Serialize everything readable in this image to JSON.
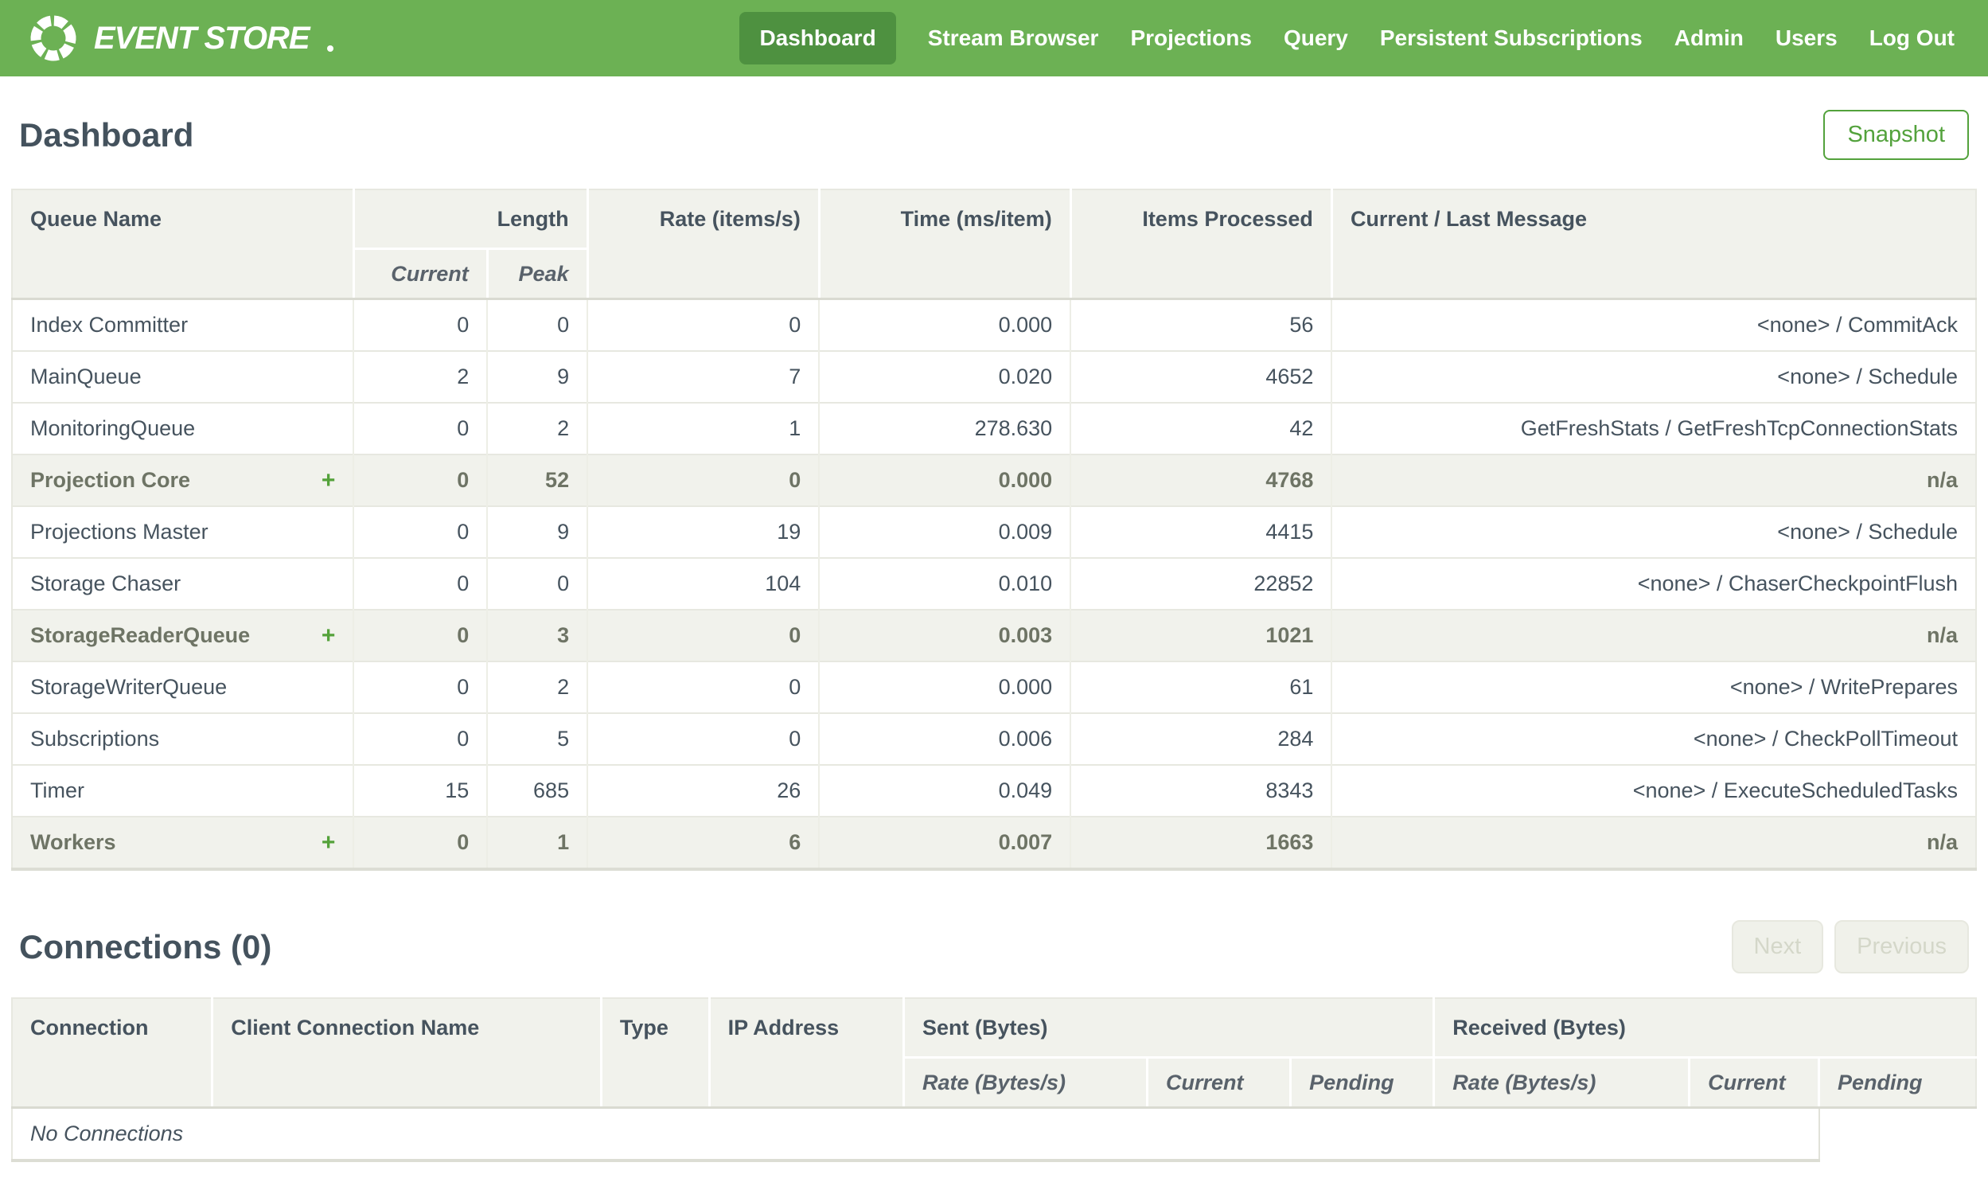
{
  "nav": {
    "brand": "EVENT STORE",
    "items": [
      {
        "label": "Dashboard",
        "active": true
      },
      {
        "label": "Stream Browser",
        "active": false
      },
      {
        "label": "Projections",
        "active": false
      },
      {
        "label": "Query",
        "active": false
      },
      {
        "label": "Persistent Subscriptions",
        "active": false
      },
      {
        "label": "Admin",
        "active": false
      },
      {
        "label": "Users",
        "active": false
      },
      {
        "label": "Log Out",
        "active": false
      }
    ]
  },
  "page": {
    "title": "Dashboard",
    "snapshot_label": "Snapshot"
  },
  "queue_table": {
    "headers": {
      "queue_name": "Queue Name",
      "length": "Length",
      "current": "Current",
      "peak": "Peak",
      "rate": "Rate (items/s)",
      "time": "Time (ms/item)",
      "items_processed": "Items Processed",
      "message": "Current / Last Message"
    },
    "rows": [
      {
        "name": "Index Committer",
        "expandable": false,
        "current": "0",
        "peak": "0",
        "rate": "0",
        "time": "0.000",
        "items": "56",
        "message": "<none> / CommitAck"
      },
      {
        "name": "MainQueue",
        "expandable": false,
        "current": "2",
        "peak": "9",
        "rate": "7",
        "time": "0.020",
        "items": "4652",
        "message": "<none> / Schedule"
      },
      {
        "name": "MonitoringQueue",
        "expandable": false,
        "current": "0",
        "peak": "2",
        "rate": "1",
        "time": "278.630",
        "items": "42",
        "message": "GetFreshStats / GetFreshTcpConnectionStats"
      },
      {
        "name": "Projection Core",
        "expandable": true,
        "current": "0",
        "peak": "52",
        "rate": "0",
        "time": "0.000",
        "items": "4768",
        "message": "n/a"
      },
      {
        "name": "Projections Master",
        "expandable": false,
        "current": "0",
        "peak": "9",
        "rate": "19",
        "time": "0.009",
        "items": "4415",
        "message": "<none> / Schedule"
      },
      {
        "name": "Storage Chaser",
        "expandable": false,
        "current": "0",
        "peak": "0",
        "rate": "104",
        "time": "0.010",
        "items": "22852",
        "message": "<none> / ChaserCheckpointFlush"
      },
      {
        "name": "StorageReaderQueue",
        "expandable": true,
        "current": "0",
        "peak": "3",
        "rate": "0",
        "time": "0.003",
        "items": "1021",
        "message": "n/a"
      },
      {
        "name": "StorageWriterQueue",
        "expandable": false,
        "current": "0",
        "peak": "2",
        "rate": "0",
        "time": "0.000",
        "items": "61",
        "message": "<none> / WritePrepares"
      },
      {
        "name": "Subscriptions",
        "expandable": false,
        "current": "0",
        "peak": "5",
        "rate": "0",
        "time": "0.006",
        "items": "284",
        "message": "<none> / CheckPollTimeout"
      },
      {
        "name": "Timer",
        "expandable": false,
        "current": "15",
        "peak": "685",
        "rate": "26",
        "time": "0.049",
        "items": "8343",
        "message": "<none> / ExecuteScheduledTasks"
      },
      {
        "name": "Workers",
        "expandable": true,
        "current": "0",
        "peak": "1",
        "rate": "6",
        "time": "0.007",
        "items": "1663",
        "message": "n/a"
      }
    ]
  },
  "connections": {
    "title": "Connections (0)",
    "pager": {
      "next": "Next",
      "previous": "Previous"
    },
    "headers": {
      "connection": "Connection",
      "client": "Client Connection Name",
      "type": "Type",
      "ip": "IP Address",
      "sent": "Sent (Bytes)",
      "received": "Received (Bytes)",
      "rate": "Rate (Bytes/s)",
      "current": "Current",
      "pending": "Pending"
    },
    "empty_message": "No Connections"
  },
  "colors": {
    "nav_green": "#6cb154",
    "active_green": "#4e9140",
    "accent_green": "#53a23c",
    "header_bg": "#f1f2ec",
    "text": "#46535e"
  }
}
